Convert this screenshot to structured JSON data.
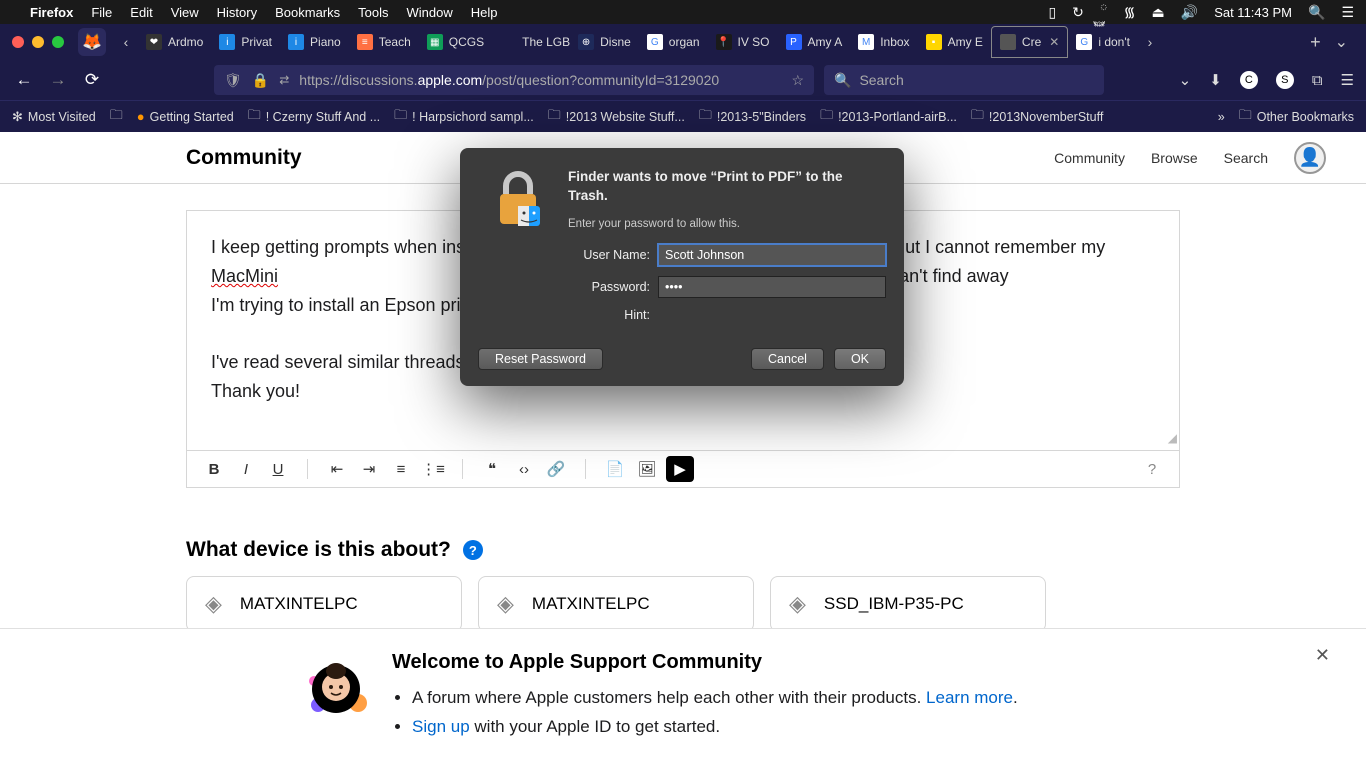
{
  "menubar": {
    "app": "Firefox",
    "items": [
      "File",
      "Edit",
      "View",
      "History",
      "Bookmarks",
      "Tools",
      "Window",
      "Help"
    ],
    "clock": "Sat 11:43 PM"
  },
  "tabs": {
    "list": [
      {
        "label": "Ardmo",
        "fav": "❤",
        "favbg": "#333"
      },
      {
        "label": "Privat",
        "fav": "i",
        "favbg": "#1e88e5"
      },
      {
        "label": "Piano",
        "fav": "i",
        "favbg": "#1e88e5"
      },
      {
        "label": "Teach",
        "fav": "≡",
        "favbg": "#ff7043"
      },
      {
        "label": "QCGS",
        "fav": "▦",
        "favbg": "#0f9d58"
      },
      {
        "label": "The LGBT",
        "fav": "",
        "favbg": "transparent"
      },
      {
        "label": "Disne",
        "fav": "⊕",
        "favbg": "#1e2a5a"
      },
      {
        "label": "organ",
        "fav": "G",
        "favbg": "#fff"
      },
      {
        "label": "IV SO",
        "fav": "📍",
        "favbg": "#1a1a1a"
      },
      {
        "label": "Amy A",
        "fav": "P",
        "favbg": "#2962ff"
      },
      {
        "label": "Inbox",
        "fav": "M",
        "favbg": "#fff"
      },
      {
        "label": "Amy E",
        "fav": "▪",
        "favbg": "#ffd600"
      },
      {
        "label": "Cre",
        "fav": "",
        "favbg": "#555",
        "active": true
      },
      {
        "label": "i don't",
        "fav": "G",
        "favbg": "#fff"
      }
    ]
  },
  "addr": {
    "url_prefix": "https://discussions.",
    "url_domain": "apple.com",
    "url_path": "/post/question?communityId=3129020",
    "search_placeholder": "Search"
  },
  "bookmarks": {
    "items": [
      "Most Visited",
      "Getting Started",
      "! Czerny Stuff And ...",
      "! Harpsichord sampl...",
      "!2013 Website Stuff...",
      "!2013-5\"Binders",
      "!2013-Portland-airB...",
      "!2013NovemberStuff"
    ],
    "other": "Other Bookmarks"
  },
  "community": {
    "title": "Community",
    "nav": [
      "Community",
      "Browse",
      "Search"
    ]
  },
  "editor": {
    "body_l1_a": "I keep getting prompts when ins",
    "body_l1_b": "ut I cannot remember my ",
    "body_l1_mac": "MacMini",
    "body_l1_c": " ",
    "body_l2_a": "word on home machine, I can't find away",
    "body_l3": "I'm trying to install an Epson pri",
    "body_p2_a": "I've read several similar threads",
    "body_p2_b": "Thank you!"
  },
  "device": {
    "question": "What device is this about?",
    "cards": [
      "MATXINTELPC",
      "MATXINTELPC",
      "SSD_IBM-P35-PC"
    ]
  },
  "welcome": {
    "title": "Welcome to Apple Support Community",
    "li1_a": "A forum where Apple customers help each other with their products. ",
    "li1_link": "Learn more",
    "li2_link": "Sign up",
    "li2_a": " with your Apple ID to get started."
  },
  "dialog": {
    "title": "Finder wants to move “Print to PDF” to the Trash.",
    "sub": "Enter your password to allow this.",
    "username_label": "User Name:",
    "username_value": "Scott Johnson",
    "password_label": "Password:",
    "password_value": "••••",
    "hint_label": "Hint:",
    "reset": "Reset Password",
    "cancel": "Cancel",
    "ok": "OK"
  }
}
